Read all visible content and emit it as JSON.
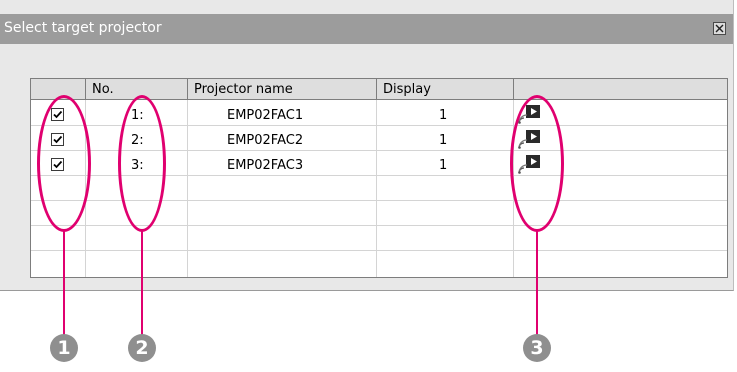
{
  "window": {
    "title": "Select target projector",
    "close_icon": "close-icon"
  },
  "table": {
    "columns": [
      "",
      "No.",
      "Projector name",
      "Display",
      ""
    ],
    "rows": [
      {
        "checked": true,
        "no": "1:",
        "name": "EMP02FAC1",
        "display": "1",
        "icon": "network-projector-icon"
      },
      {
        "checked": true,
        "no": "2:",
        "name": "EMP02FAC2",
        "display": "1",
        "icon": "network-projector-icon"
      },
      {
        "checked": true,
        "no": "3:",
        "name": "EMP02FAC3",
        "display": "1",
        "icon": "network-projector-icon"
      }
    ]
  },
  "callouts": [
    "1",
    "2",
    "3"
  ],
  "colors": {
    "highlight": "#e0006f",
    "titlebar": "#9c9c9c",
    "callout": "#8f8f8f"
  }
}
